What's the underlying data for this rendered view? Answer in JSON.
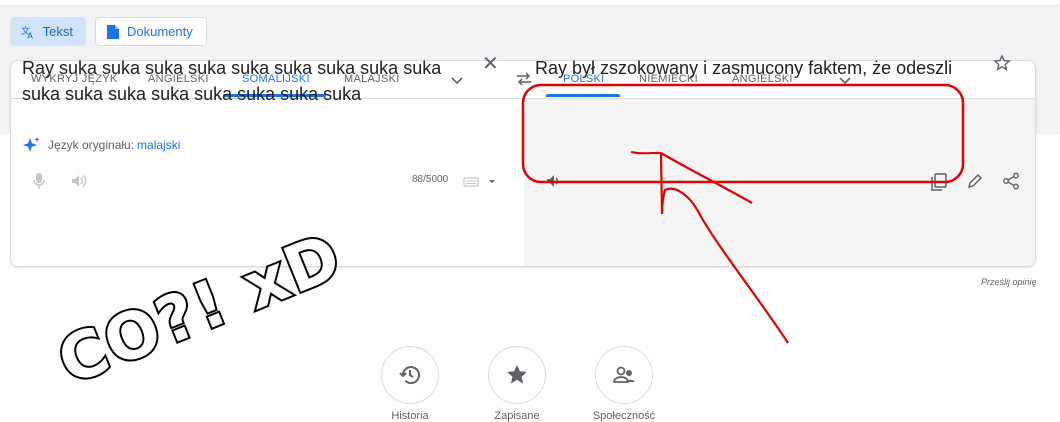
{
  "modes": {
    "text_label": "Tekst",
    "docs_label": "Dokumenty"
  },
  "source_langs": [
    {
      "label": "WYKRYJ JĘZYK"
    },
    {
      "label": "ANGIELSKI"
    },
    {
      "label": "SOMALIJSKI",
      "active": true
    },
    {
      "label": "MALAJSKI"
    }
  ],
  "target_langs": [
    {
      "label": "POLSKI",
      "active": true
    },
    {
      "label": "NIEMIECKI"
    },
    {
      "label": "ANGIELSKI"
    }
  ],
  "source": {
    "text": "Ray suka suka suka suka suka suka suka suka suka suka suka suka suka suka suka suka suka",
    "detected_prefix": "Język oryginału:",
    "detected_lang": "malajski",
    "char_count": "88/5000"
  },
  "output": {
    "text": "Ray był zszokowany i zasmucony faktem, że odeszli"
  },
  "feedback_label": "Prześlij opinię",
  "bottom_buttons": [
    {
      "label": "Historia",
      "icon": "history-icon"
    },
    {
      "label": "Zapisane",
      "icon": "star-icon"
    },
    {
      "label": "Społeczność",
      "icon": "community-icon"
    }
  ],
  "annotation": {
    "sticker_text": "CO?! xD",
    "highlight_color": "#e00000"
  },
  "colors": {
    "accent": "#1a73e8",
    "active_mode_bg": "#d2e3fc",
    "output_bg": "#f5f5f5"
  }
}
